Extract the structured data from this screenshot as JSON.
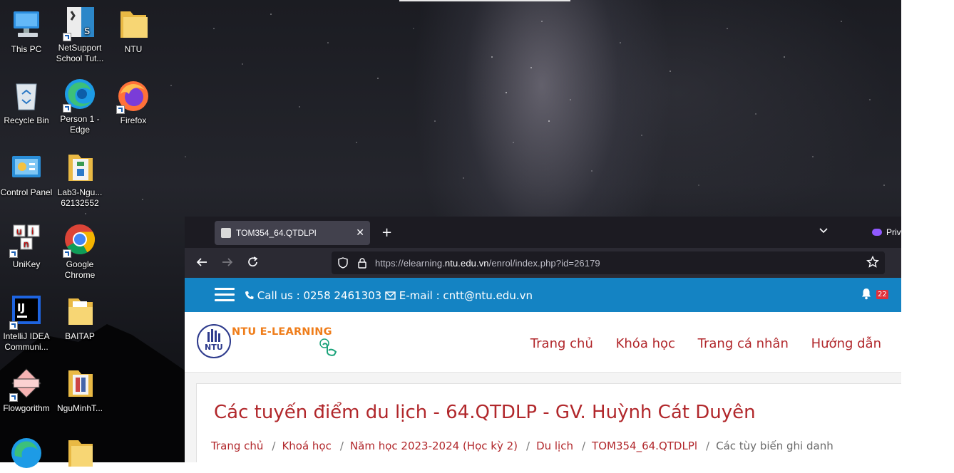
{
  "desktop": {
    "icons": [
      {
        "label": "This PC",
        "icon": "this-pc-icon"
      },
      {
        "label": "NetSupport School Tut...",
        "icon": "netsupport-icon"
      },
      {
        "label": "NTU",
        "icon": "folder-icon"
      },
      {
        "label": "Recycle Bin",
        "icon": "recycle-bin-icon"
      },
      {
        "label": "Person 1 - Edge",
        "icon": "edge-icon"
      },
      {
        "label": "Firefox",
        "icon": "firefox-icon"
      },
      {
        "label": "Control Panel",
        "icon": "control-panel-icon"
      },
      {
        "label": "Lab3-Ngu... 62132552",
        "icon": "zip-folder-icon"
      },
      {
        "label": "UniKey",
        "icon": "unikey-icon"
      },
      {
        "label": "Google Chrome",
        "icon": "chrome-icon"
      },
      {
        "label": "IntelliJ IDEA Communi...",
        "icon": "intellij-icon"
      },
      {
        "label": "BAITAP",
        "icon": "folder-icon"
      },
      {
        "label": "Flowgorithm",
        "icon": "flowgorithm-icon"
      },
      {
        "label": "NguMinhT...",
        "icon": "folder-icon"
      }
    ]
  },
  "browser": {
    "tab_title": "TOM354_64.QTDLPl",
    "close_symbol": "✕",
    "new_tab_symbol": "+",
    "private_label": "Priv",
    "url_prefix": "https://elearning.",
    "url_domain": "ntu.edu.vn",
    "url_suffix": "/enrol/index.php?id=26179"
  },
  "page": {
    "topbar": {
      "phone_label": "Call us : 0258 2461303",
      "email_label": "E-mail : cntt@ntu.edu.vn",
      "notification_count": "22"
    },
    "logo_text": "NTU E-LEARNING",
    "nav": [
      "Trang chủ",
      "Khóa học",
      "Trang cá nhân",
      "Hướng dẫn"
    ],
    "course_title": "Các tuyến điểm du lịch - 64.QTDLP - GV. Huỳnh Cát Duyên",
    "breadcrumb": {
      "items": [
        "Trang chủ",
        "Khoá học",
        "Năm học 2023-2024 (Học kỳ 2)",
        "Du lịch",
        "TOM354_64.QTDLPl"
      ],
      "current": "Các tùy biến ghi danh",
      "separator": "/"
    }
  },
  "colors": {
    "topbar_blue": "#1483c3",
    "brand_red": "#b1272b",
    "logo_orange": "#ef7d1a",
    "browser_dark": "#1c1b22"
  }
}
